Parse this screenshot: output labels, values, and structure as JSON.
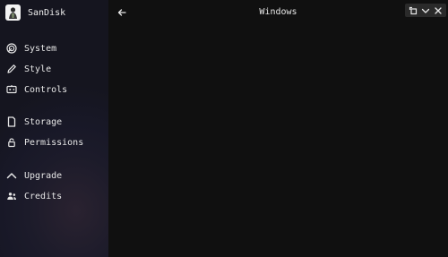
{
  "app": {
    "name": "SanDisk"
  },
  "header": {
    "title": "Windows"
  },
  "sidebar": {
    "items": [
      {
        "label": "System",
        "icon": "system-icon"
      },
      {
        "label": "Style",
        "icon": "pencil-icon"
      },
      {
        "label": "Controls",
        "icon": "controls-icon"
      },
      {
        "label": "Storage",
        "icon": "document-icon"
      },
      {
        "label": "Permissions",
        "icon": "lock-icon"
      },
      {
        "label": "Upgrade",
        "icon": "chevron-up-icon"
      },
      {
        "label": "Credits",
        "icon": "people-icon"
      }
    ]
  },
  "window_controls": [
    "restore-icon",
    "chevron-down-icon",
    "close-icon"
  ],
  "colors": {
    "sidebar_bg": "#1a1a29",
    "main_bg": "#101010",
    "text": "#e8e8e8"
  }
}
